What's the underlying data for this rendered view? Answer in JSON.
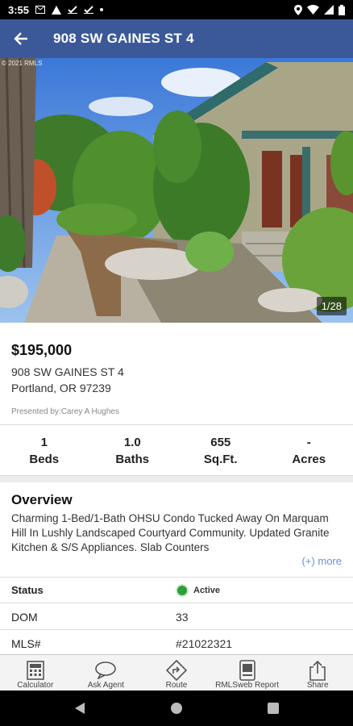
{
  "status_bar": {
    "time": "3:55",
    "icons": [
      "gmail-icon",
      "alert-icon",
      "check-icon",
      "check-icon",
      "dot-icon"
    ],
    "right_icons": [
      "location-icon",
      "wifi-icon",
      "signal-icon",
      "battery-icon"
    ]
  },
  "app_bar": {
    "title": "908 SW GAINES ST 4",
    "back_icon": "arrow-left-icon",
    "color": "#3b5998"
  },
  "photo": {
    "counter": "1/28",
    "copyright": "© 2021 RMLS"
  },
  "listing": {
    "price": "$195,000",
    "address_line1": "908 SW GAINES ST 4",
    "address_line2": "Portland, OR 97239",
    "presented_by": "Presented by:Carey A Hughes"
  },
  "facts": [
    {
      "value": "1",
      "label": "Beds"
    },
    {
      "value": "1.0",
      "label": "Baths"
    },
    {
      "value": "655",
      "label": "Sq.Ft."
    },
    {
      "value": "-",
      "label": "Acres"
    }
  ],
  "overview": {
    "title": "Overview",
    "text": "Charming 1-Bed/1-Bath OHSU Condo Tucked Away On Marquam Hill In Lushly Landscaped Courtyard Community. Updated Granite Kitchen & S/S Appliances. Slab Counters",
    "more_label": "(+) more"
  },
  "details": [
    {
      "label": "Status",
      "value": "Active",
      "status_color": "#2e9e3c"
    },
    {
      "label": "DOM",
      "value": "33"
    },
    {
      "label": "MLS#",
      "value": "#21022321"
    }
  ],
  "bottom_nav": [
    {
      "label": "Calculator",
      "icon": "calculator-icon"
    },
    {
      "label": "Ask Agent",
      "icon": "chat-bubble-icon"
    },
    {
      "label": "Route",
      "icon": "route-icon"
    },
    {
      "label": "RMLSweb Report",
      "icon": "report-icon"
    },
    {
      "label": "Share",
      "icon": "share-icon"
    }
  ],
  "system_nav": [
    "back-triangle-icon",
    "home-circle-icon",
    "recents-square-icon"
  ]
}
